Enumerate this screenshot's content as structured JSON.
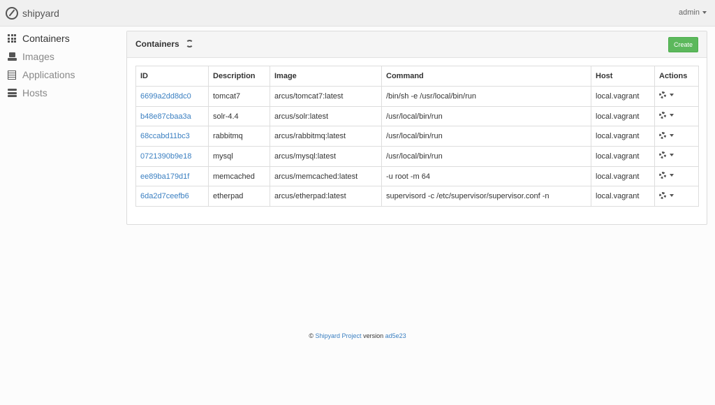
{
  "navbar": {
    "brand": "shipyard",
    "user": "admin"
  },
  "sidebar": {
    "items": [
      {
        "label": "Containers",
        "icon": "grid-icon",
        "active": true
      },
      {
        "label": "Images",
        "icon": "drive-icon",
        "active": false
      },
      {
        "label": "Applications",
        "icon": "list-icon",
        "active": false
      },
      {
        "label": "Hosts",
        "icon": "server-icon",
        "active": false
      }
    ]
  },
  "panel": {
    "title": "Containers",
    "create_label": "Create"
  },
  "table": {
    "headers": [
      "ID",
      "Description",
      "Image",
      "Command",
      "Host",
      "Actions"
    ],
    "rows": [
      {
        "id": "6699a2dd8dc0",
        "description": "tomcat7",
        "image": "arcus/tomcat7:latest",
        "command": "/bin/sh -e /usr/local/bin/run",
        "host": "local.vagrant"
      },
      {
        "id": "b48e87cbaa3a",
        "description": "solr-4.4",
        "image": "arcus/solr:latest",
        "command": "/usr/local/bin/run",
        "host": "local.vagrant"
      },
      {
        "id": "68ccabd11bc3",
        "description": "rabbitmq",
        "image": "arcus/rabbitmq:latest",
        "command": "/usr/local/bin/run",
        "host": "local.vagrant"
      },
      {
        "id": "0721390b9e18",
        "description": "mysql",
        "image": "arcus/mysql:latest",
        "command": "/usr/local/bin/run",
        "host": "local.vagrant"
      },
      {
        "id": "ee89ba179d1f",
        "description": "memcached",
        "image": "arcus/memcached:latest",
        "command": "-u root -m 64",
        "host": "local.vagrant"
      },
      {
        "id": "6da2d7ceefb6",
        "description": "etherpad",
        "image": "arcus/etherpad:latest",
        "command": "supervisord -c /etc/supervisor/supervisor.conf -n",
        "host": "local.vagrant"
      }
    ]
  },
  "footer": {
    "copyright": "©",
    "project_link": "Shipyard Project",
    "version_label": "version",
    "version": "ad5e23"
  },
  "colors": {
    "accent": "#3a7fc1",
    "create_button": "#5cb85c"
  }
}
